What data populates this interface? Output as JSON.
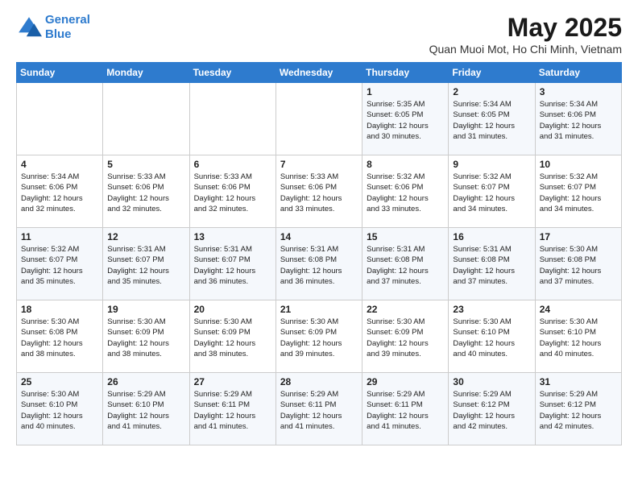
{
  "logo": {
    "line1": "General",
    "line2": "Blue"
  },
  "title": "May 2025",
  "subtitle": "Quan Muoi Mot, Ho Chi Minh, Vietnam",
  "headers": [
    "Sunday",
    "Monday",
    "Tuesday",
    "Wednesday",
    "Thursday",
    "Friday",
    "Saturday"
  ],
  "weeks": [
    [
      {
        "day": "",
        "content": ""
      },
      {
        "day": "",
        "content": ""
      },
      {
        "day": "",
        "content": ""
      },
      {
        "day": "",
        "content": ""
      },
      {
        "day": "1",
        "content": "Sunrise: 5:35 AM\nSunset: 6:05 PM\nDaylight: 12 hours\nand 30 minutes."
      },
      {
        "day": "2",
        "content": "Sunrise: 5:34 AM\nSunset: 6:05 PM\nDaylight: 12 hours\nand 31 minutes."
      },
      {
        "day": "3",
        "content": "Sunrise: 5:34 AM\nSunset: 6:06 PM\nDaylight: 12 hours\nand 31 minutes."
      }
    ],
    [
      {
        "day": "4",
        "content": "Sunrise: 5:34 AM\nSunset: 6:06 PM\nDaylight: 12 hours\nand 32 minutes."
      },
      {
        "day": "5",
        "content": "Sunrise: 5:33 AM\nSunset: 6:06 PM\nDaylight: 12 hours\nand 32 minutes."
      },
      {
        "day": "6",
        "content": "Sunrise: 5:33 AM\nSunset: 6:06 PM\nDaylight: 12 hours\nand 32 minutes."
      },
      {
        "day": "7",
        "content": "Sunrise: 5:33 AM\nSunset: 6:06 PM\nDaylight: 12 hours\nand 33 minutes."
      },
      {
        "day": "8",
        "content": "Sunrise: 5:32 AM\nSunset: 6:06 PM\nDaylight: 12 hours\nand 33 minutes."
      },
      {
        "day": "9",
        "content": "Sunrise: 5:32 AM\nSunset: 6:07 PM\nDaylight: 12 hours\nand 34 minutes."
      },
      {
        "day": "10",
        "content": "Sunrise: 5:32 AM\nSunset: 6:07 PM\nDaylight: 12 hours\nand 34 minutes."
      }
    ],
    [
      {
        "day": "11",
        "content": "Sunrise: 5:32 AM\nSunset: 6:07 PM\nDaylight: 12 hours\nand 35 minutes."
      },
      {
        "day": "12",
        "content": "Sunrise: 5:31 AM\nSunset: 6:07 PM\nDaylight: 12 hours\nand 35 minutes."
      },
      {
        "day": "13",
        "content": "Sunrise: 5:31 AM\nSunset: 6:07 PM\nDaylight: 12 hours\nand 36 minutes."
      },
      {
        "day": "14",
        "content": "Sunrise: 5:31 AM\nSunset: 6:08 PM\nDaylight: 12 hours\nand 36 minutes."
      },
      {
        "day": "15",
        "content": "Sunrise: 5:31 AM\nSunset: 6:08 PM\nDaylight: 12 hours\nand 37 minutes."
      },
      {
        "day": "16",
        "content": "Sunrise: 5:31 AM\nSunset: 6:08 PM\nDaylight: 12 hours\nand 37 minutes."
      },
      {
        "day": "17",
        "content": "Sunrise: 5:30 AM\nSunset: 6:08 PM\nDaylight: 12 hours\nand 37 minutes."
      }
    ],
    [
      {
        "day": "18",
        "content": "Sunrise: 5:30 AM\nSunset: 6:08 PM\nDaylight: 12 hours\nand 38 minutes."
      },
      {
        "day": "19",
        "content": "Sunrise: 5:30 AM\nSunset: 6:09 PM\nDaylight: 12 hours\nand 38 minutes."
      },
      {
        "day": "20",
        "content": "Sunrise: 5:30 AM\nSunset: 6:09 PM\nDaylight: 12 hours\nand 38 minutes."
      },
      {
        "day": "21",
        "content": "Sunrise: 5:30 AM\nSunset: 6:09 PM\nDaylight: 12 hours\nand 39 minutes."
      },
      {
        "day": "22",
        "content": "Sunrise: 5:30 AM\nSunset: 6:09 PM\nDaylight: 12 hours\nand 39 minutes."
      },
      {
        "day": "23",
        "content": "Sunrise: 5:30 AM\nSunset: 6:10 PM\nDaylight: 12 hours\nand 40 minutes."
      },
      {
        "day": "24",
        "content": "Sunrise: 5:30 AM\nSunset: 6:10 PM\nDaylight: 12 hours\nand 40 minutes."
      }
    ],
    [
      {
        "day": "25",
        "content": "Sunrise: 5:30 AM\nSunset: 6:10 PM\nDaylight: 12 hours\nand 40 minutes."
      },
      {
        "day": "26",
        "content": "Sunrise: 5:29 AM\nSunset: 6:10 PM\nDaylight: 12 hours\nand 41 minutes."
      },
      {
        "day": "27",
        "content": "Sunrise: 5:29 AM\nSunset: 6:11 PM\nDaylight: 12 hours\nand 41 minutes."
      },
      {
        "day": "28",
        "content": "Sunrise: 5:29 AM\nSunset: 6:11 PM\nDaylight: 12 hours\nand 41 minutes."
      },
      {
        "day": "29",
        "content": "Sunrise: 5:29 AM\nSunset: 6:11 PM\nDaylight: 12 hours\nand 41 minutes."
      },
      {
        "day": "30",
        "content": "Sunrise: 5:29 AM\nSunset: 6:12 PM\nDaylight: 12 hours\nand 42 minutes."
      },
      {
        "day": "31",
        "content": "Sunrise: 5:29 AM\nSunset: 6:12 PM\nDaylight: 12 hours\nand 42 minutes."
      }
    ]
  ]
}
